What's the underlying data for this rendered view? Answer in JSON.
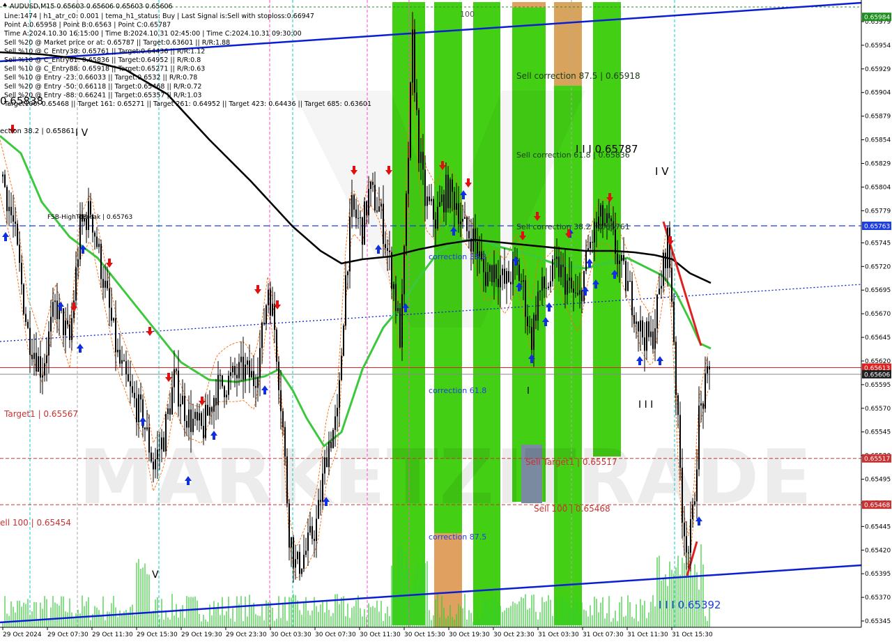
{
  "chart_data": {
    "type": "candlestick",
    "symbol_line": "AUDUSD,M15  0.65603 0.65606 0.65603 0.65606",
    "info_lines": [
      "Line:1474  |  h1_atr_c0: 0.001  |  tema_h1_status: Buy  |  Last Signal is:Sell with stoploss:0.66947",
      "Point A:0.65958  |  Point B:0.6563  |  Point C:0.65787",
      "Time A:2024.10.30 16:15:00  |  Time B:2024.10.31 02:45:00  |  Time C:2024.10.31 09:30:00",
      "Sell %20 @ Market price or at: 0.65787  ||  Target:0.63601  ||  R/R:1.88",
      "Sell %10 @ C_Entry38: 0.65761  ||  Target:0.64436  ||  R/R:1.12",
      "Sell %10 @ C_Entry61: 0.65836  ||  Target:0.64952  ||  R/R:0.8",
      "Sell %10 @ C_Entry88: 0.65918  ||  Target:0.65271  ||  R/R:0.63",
      "Sell %10 @ Entry -23: 0.66033  ||  Target:0.6532  ||  R/R:0.78",
      "Sell %20 @ Entry -50: 0.66118  ||  Target:0.65468  ||  R/R:0.72",
      "Sell %20 @ Entry -88: 0.66241  ||  Target:0.65357  ||  R/R:1.03",
      "Target100: 0.65468  ||  Target 161: 0.65271  ||  Target 261: 0.64952  ||  Target 423: 0.64436  ||  Target 685: 0.63601"
    ],
    "y_ticks": [
      "0.65979",
      "0.65954",
      "0.65929",
      "0.65904",
      "0.65879",
      "0.65854",
      "0.65829",
      "0.65804",
      "0.65779",
      "0.65745",
      "0.65720",
      "0.65695",
      "0.65670",
      "0.65645",
      "0.65620",
      "0.65595",
      "0.65570",
      "0.65545",
      "0.65520",
      "0.65495",
      "0.65470",
      "0.65445",
      "0.65420",
      "0.65395",
      "0.65370",
      "0.65345"
    ],
    "x_ticks": [
      "29 Oct 2024",
      "29 Oct 07:30",
      "29 Oct 11:30",
      "29 Oct 15:30",
      "29 Oct 19:30",
      "29 Oct 23:30",
      "30 Oct 03:30",
      "30 Oct 07:30",
      "30 Oct 11:30",
      "30 Oct 15:30",
      "30 Oct 19:30",
      "30 Oct 23:30",
      "31 Oct 03:30",
      "31 Oct 07:30",
      "31 Oct 11:30",
      "31 Oct 15:30"
    ],
    "ylim": [
      0.65336,
      0.65984
    ],
    "price_tags": [
      {
        "text": "0.65984",
        "value": 0.65984,
        "color": "#1f8f1f"
      },
      {
        "text": "0.65763",
        "value": 0.65763,
        "color": "#1e3fe0"
      },
      {
        "text": "0.65613",
        "value": 0.65613,
        "color": "#e02020"
      },
      {
        "text": "0.65606",
        "value": 0.65606,
        "color": "#202020"
      },
      {
        "text": "0.65517",
        "value": 0.65517,
        "color": "#c83232"
      },
      {
        "text": "0.65468",
        "value": 0.65468,
        "color": "#c83232"
      }
    ],
    "annotations": [
      {
        "text": "Sell correction 87.5 | 0.65918",
        "color": "#1a3a1a"
      },
      {
        "text": "Sell correction 61.8 | 0.65836",
        "color": "#1a3a1a"
      },
      {
        "text": "Sell correction 38.2 | 0.65761",
        "color": "#1a3a1a"
      },
      {
        "text": "correction 38.2",
        "color": "#1e3fe0"
      },
      {
        "text": "correction 61.8",
        "color": "#1e3fe0"
      },
      {
        "text": "correction 87.5",
        "color": "#1e3fe0"
      },
      {
        "text": "Sell Target1 | 0.65517",
        "color": "#c83232"
      },
      {
        "text": "Sell 100 | 0.65468",
        "color": "#c83232"
      },
      {
        "text": "Target1 | 0.65567",
        "color": "#c83232"
      },
      {
        "text": "ell 100 | 0.65454",
        "color": "#c83232"
      },
      {
        "text": "FSB-HighToBreak | 0.65763",
        "color": "#000000"
      },
      {
        "text": "I I I 0.65787",
        "color": "#000000"
      },
      {
        "text": "I I I 0.65392",
        "color": "#1e3fe0"
      },
      {
        "text": "ection 38.2 | 0.65861",
        "color": "#000000"
      },
      {
        "text": "0.65838",
        "color": "#000000"
      },
      {
        "text": "I V",
        "color": "#000000"
      },
      {
        "text": "I V",
        "color": "#000000"
      },
      {
        "text": "I I I",
        "color": "#000000"
      },
      {
        "text": "V",
        "color": "#000000"
      },
      {
        "text": "I",
        "color": "#000000"
      },
      {
        "text": "100",
        "color": "#555555"
      }
    ],
    "watermark": "MARKETZITRADE",
    "colors": {
      "green_zone": "#33cc00",
      "orange_zone": "#e0a060",
      "ma_green": "#3cc83c",
      "ma_black": "#000000",
      "channel_blue": "#0a1ed2",
      "red_line": "#e02020",
      "orange_dash": "#ff6600",
      "volume": "#33cc33",
      "candle": "#000000"
    }
  }
}
